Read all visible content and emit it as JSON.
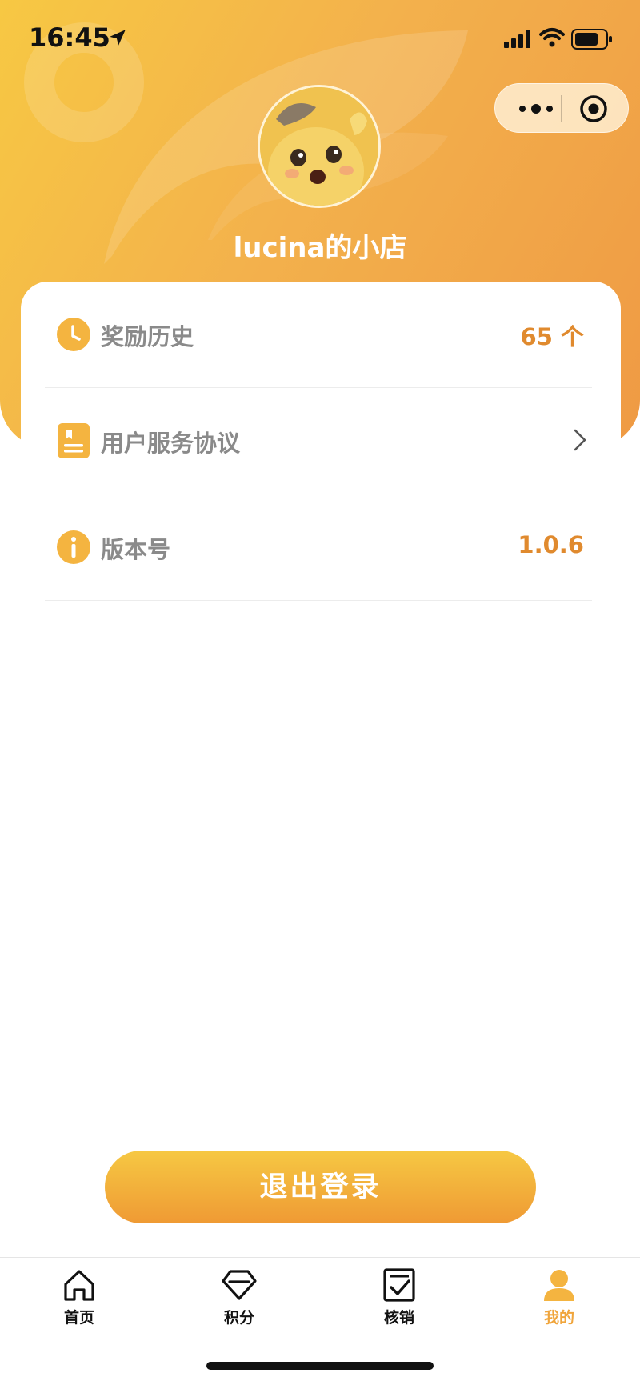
{
  "status_bar": {
    "time": "16:45"
  },
  "profile": {
    "shop_name": "lucina的小店"
  },
  "menu": {
    "items": [
      {
        "label": "奖励历史",
        "value": "65 个",
        "icon": "clock-icon"
      },
      {
        "label": "用户服务协议",
        "value": "",
        "icon": "document-icon"
      },
      {
        "label": "版本号",
        "value": "1.0.6",
        "icon": "info-icon"
      }
    ]
  },
  "actions": {
    "logout_label": "退出登录"
  },
  "tabbar": {
    "tabs": [
      {
        "label": "首页",
        "icon": "home-icon"
      },
      {
        "label": "积分",
        "icon": "gem-icon"
      },
      {
        "label": "核销",
        "icon": "checklist-icon"
      },
      {
        "label": "我的",
        "icon": "user-icon",
        "active": true
      }
    ]
  },
  "colors": {
    "accent": "#f0a53c",
    "value_text": "#e08a2e",
    "header_start": "#f7c843",
    "header_end": "#ef9a44"
  }
}
